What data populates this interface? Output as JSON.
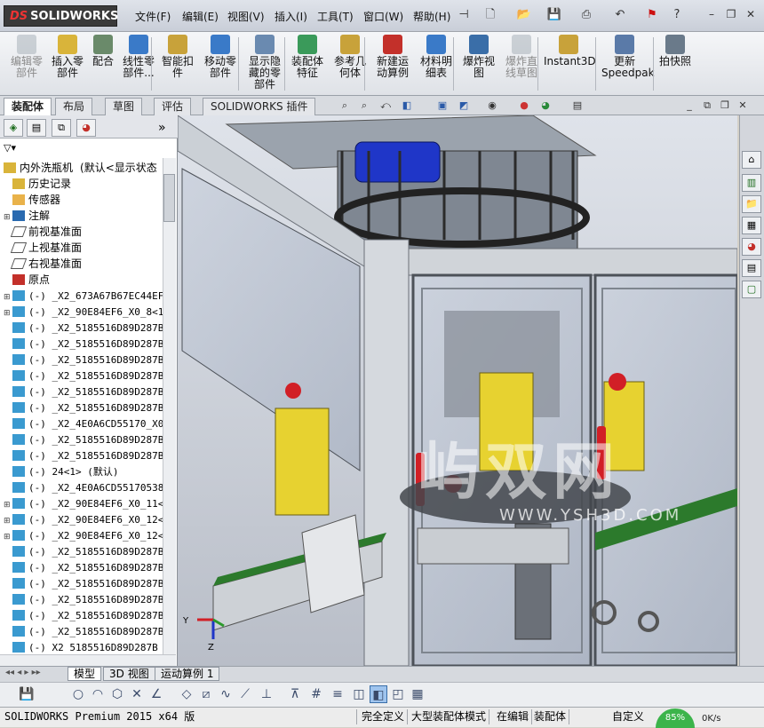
{
  "app": {
    "logo_prefix": "DS",
    "logo_text": "SOLIDWORKS"
  },
  "menu": [
    "文件(F)",
    "编辑(E)",
    "视图(V)",
    "插入(I)",
    "工具(T)",
    "窗口(W)",
    "帮助(H)"
  ],
  "ribbon": {
    "buttons": [
      {
        "label": "编辑零\n部件",
        "disabled": true
      },
      {
        "label": "插入零\n部件"
      },
      {
        "label": "配合"
      },
      {
        "label": "线性零\n部件..."
      },
      {
        "label": "智能扣\n件"
      },
      {
        "label": "移动零\n部件"
      },
      {
        "label": "显示隐\n藏的零\n部件"
      },
      {
        "label": "装配体\n特征"
      },
      {
        "label": "参考几\n何体"
      },
      {
        "label": "新建运\n动算例"
      },
      {
        "label": "材料明\n细表"
      },
      {
        "label": "爆炸视\n图"
      },
      {
        "label": "爆炸直\n线草图",
        "disabled": true
      },
      {
        "label": "Instant3D"
      },
      {
        "label": "更新\nSpeedpak"
      },
      {
        "label": "拍快照"
      }
    ]
  },
  "tabs": [
    "装配体",
    "布局",
    "草图",
    "评估",
    "SOLIDWORKS 插件"
  ],
  "tree": {
    "root": "内外洗瓶机",
    "root_suffix": "(默认<显示状态",
    "items": [
      {
        "label": "历史记录",
        "type": "folder"
      },
      {
        "label": "传感器",
        "type": "sensor"
      },
      {
        "label": "注解",
        "type": "annotation",
        "expand": true
      },
      {
        "label": "前视基准面",
        "type": "plane"
      },
      {
        "label": "上视基准面",
        "type": "plane"
      },
      {
        "label": "右视基准面",
        "type": "plane"
      },
      {
        "label": "原点",
        "type": "origin"
      },
      {
        "label": "(-) _X2_673A67B67EC44EF",
        "type": "part",
        "expand": true
      },
      {
        "label": "(-) _X2_90E84EF6_X0_8<1",
        "type": "part",
        "expand": true
      },
      {
        "label": "(-) _X2_5185516D89D287B",
        "type": "part"
      },
      {
        "label": "(-) _X2_5185516D89D287B",
        "type": "part"
      },
      {
        "label": "(-) _X2_5185516D89D287B",
        "type": "part"
      },
      {
        "label": "(-) _X2_5185516D89D287B",
        "type": "part"
      },
      {
        "label": "(-) _X2_5185516D89D287B",
        "type": "part"
      },
      {
        "label": "(-) _X2_5185516D89D287B",
        "type": "part"
      },
      {
        "label": "(-) _X2_4E0A6CD55170_X0",
        "type": "part"
      },
      {
        "label": "(-) _X2_5185516D89D287B",
        "type": "part"
      },
      {
        "label": "(-) _X2_5185516D89D287B",
        "type": "part"
      },
      {
        "label": "(-) 24<1> (默认)",
        "type": "part"
      },
      {
        "label": "(-) _X2_4E0A6CD55170538",
        "type": "part"
      },
      {
        "label": "(-) _X2_90E84EF6_X0_11<",
        "type": "part",
        "expand": true
      },
      {
        "label": "(-) _X2_90E84EF6_X0_12<",
        "type": "part",
        "expand": true
      },
      {
        "label": "(-) _X2_90E84EF6_X0_12<",
        "type": "part",
        "expand": true
      },
      {
        "label": "(-) _X2_5185516D89D287B",
        "type": "part"
      },
      {
        "label": "(-) _X2_5185516D89D287B",
        "type": "part"
      },
      {
        "label": "(-) _X2_5185516D89D287B",
        "type": "part"
      },
      {
        "label": "(-) _X2_5185516D89D287B",
        "type": "part"
      },
      {
        "label": "(-) _X2_5185516D89D287B",
        "type": "part"
      },
      {
        "label": "(-) _X2_5185516D89D287B",
        "type": "part"
      },
      {
        "label": "(-) X2 5185516D89D287B",
        "type": "part"
      }
    ]
  },
  "bottom_tabs": [
    "模型",
    "3D 视图",
    "运动算例 1"
  ],
  "status": {
    "product": "SOLIDWORKS Premium 2015 x64 版",
    "defined": "完全定义",
    "mode": "大型装配体模式",
    "editing": "在编辑",
    "doc": "装配体",
    "units": "自定义",
    "net_percent": "85%",
    "net_speed": "0K/s"
  },
  "watermark": {
    "main": "屿双网",
    "sub": "WWW.YSH3D.COM"
  },
  "colors": {
    "frame": "#cfd3d8",
    "accent_red": "#d11f26",
    "accent_yellow": "#e7d230",
    "accent_blue": "#1f36c8",
    "net": "#3cb44b"
  }
}
